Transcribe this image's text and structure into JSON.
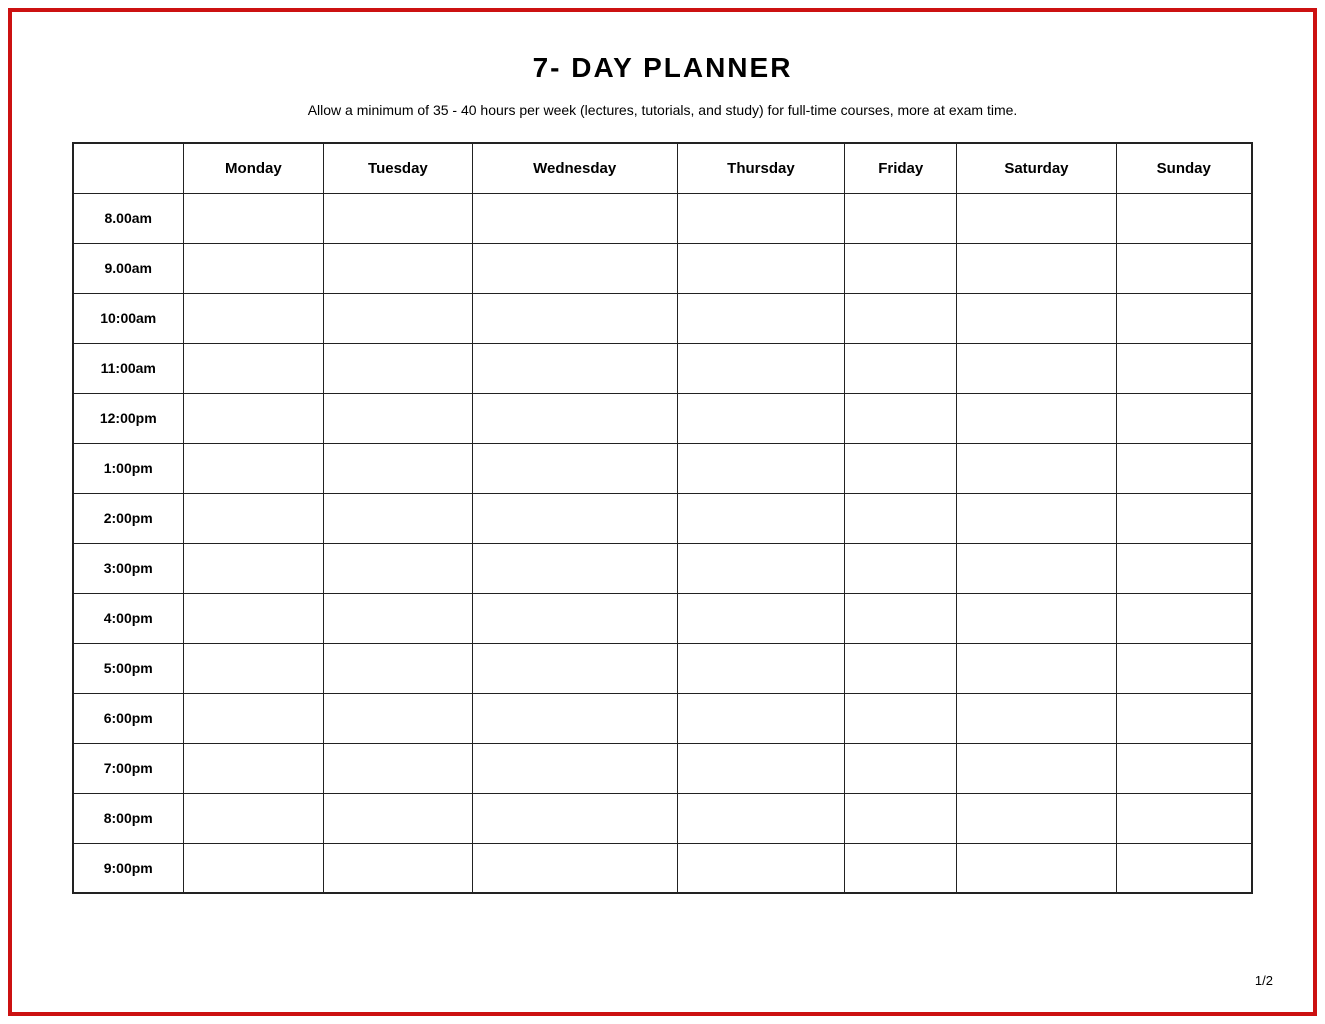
{
  "page": {
    "title": "7- DAY PLANNER",
    "subtitle": "Allow a minimum of 35 - 40 hours per week (lectures, tutorials, and study) for full-time courses, more at exam time.",
    "page_number": "1/2"
  },
  "table": {
    "days": [
      "Monday",
      "Tuesday",
      "Wednesday",
      "Thursday",
      "Friday",
      "Saturday",
      "Sunday"
    ],
    "time_slots": [
      "8.00am",
      "9.00am",
      "10:00am",
      "11:00am",
      "12:00pm",
      "1:00pm",
      "2:00pm",
      "3:00pm",
      "4:00pm",
      "5:00pm",
      "6:00pm",
      "7:00pm",
      "8:00pm",
      "9:00pm"
    ]
  }
}
